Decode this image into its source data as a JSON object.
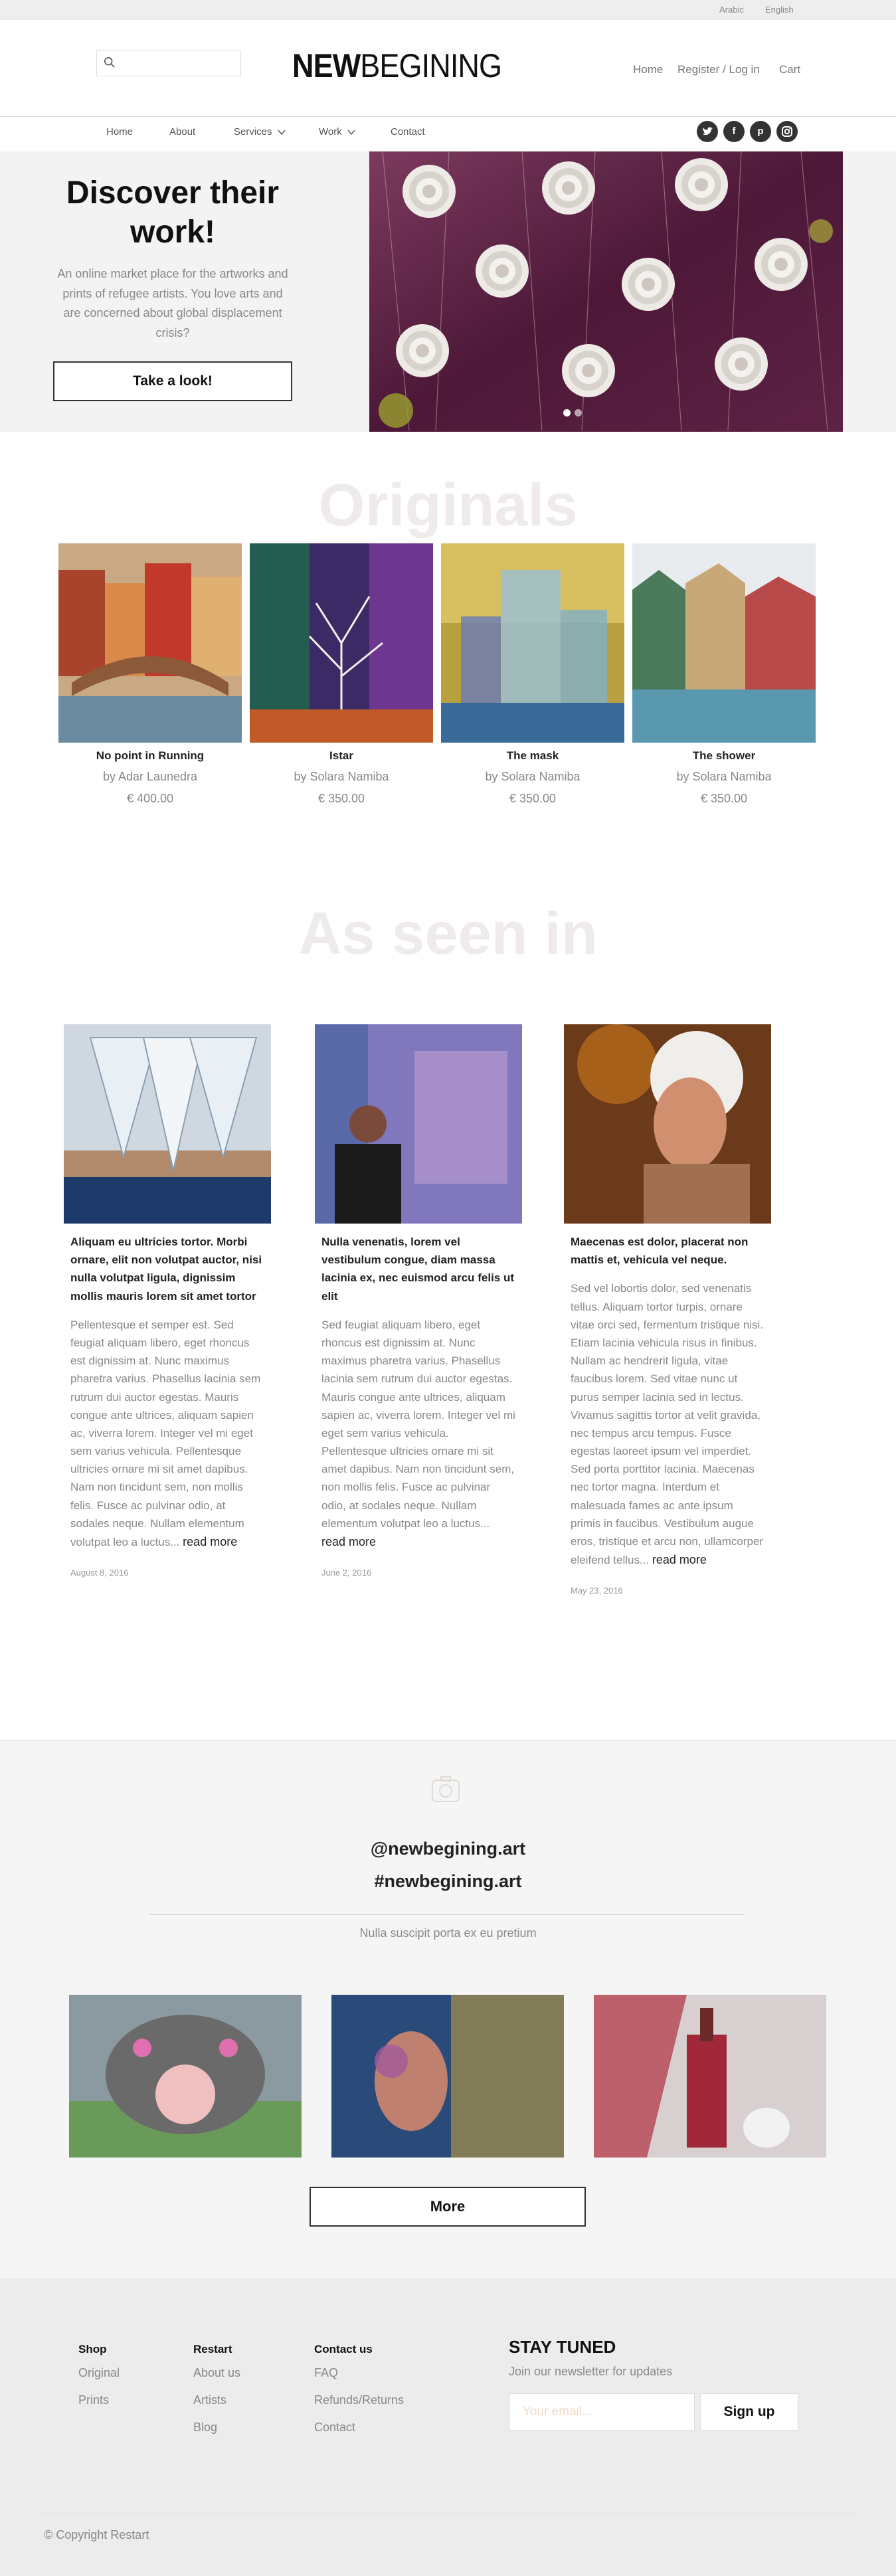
{
  "language_bar": {
    "arabic": "Arabic",
    "english": "English"
  },
  "header": {
    "search": {
      "value": "",
      "placeholder": "",
      "icon": "search-icon"
    },
    "logo": {
      "bold": "NEW",
      "regular": "BEGINING"
    },
    "links": {
      "home": "Home",
      "register": "Register / Log in",
      "cart": "Cart"
    }
  },
  "nav": {
    "items": [
      "Home",
      "About",
      "Services",
      "Work",
      "Contact"
    ],
    "dropdowns": [
      "Services",
      "Work"
    ],
    "social_icons": [
      "twitter-icon",
      "facebook-icon",
      "pinterest-icon",
      "instagram-icon"
    ]
  },
  "hero": {
    "title": "Discover their work!",
    "text": "An online market place for the artworks and prints of refugee artists. You love arts and are concerned about global displacement crisis?",
    "button": "Take a look!",
    "slide_count": 2,
    "active_slide": 1
  },
  "originals": {
    "heading": "Originals",
    "items": [
      {
        "title": "No point in Running",
        "by": "by Adar Launedra",
        "price": "€ 400.00"
      },
      {
        "title": "Istar",
        "by": "by Solara Namiba",
        "price": "€ 350.00"
      },
      {
        "title": "The mask",
        "by": "by Solara Namiba",
        "price": "€ 350.00"
      },
      {
        "title": "The shower",
        "by": "by Solara Namiba",
        "price": "€ 350.00"
      }
    ]
  },
  "press": {
    "heading": "As seen in",
    "read_more": "read more",
    "items": [
      {
        "title": "Aliquam eu ultricies tortor. Morbi ornare, elit non volutpat auctor, nisi nulla volutpat ligula, dignissim mollis mauris lorem sit amet tortor",
        "body": "Pellentesque et semper est. Sed feugiat aliquam libero, eget rhoncus est dignissim at. Nunc maximus pharetra varius. Phasellus lacinia sem rutrum dui auctor egestas. Mauris congue ante ultrices, aliquam sapien ac, viverra lorem. Integer vel mi eget sem varius vehicula. Pellentesque ultricies ornare mi sit amet dapibus. Nam non tincidunt sem, non mollis felis. Fusce ac pulvinar odio, at sodales neque. Nullam elementum volutpat leo a luctus...",
        "date": "August 8, 2016"
      },
      {
        "title": "Nulla venenatis, lorem vel vestibulum congue, diam massa lacinia ex, nec euismod arcu felis ut elit",
        "body": "Sed feugiat aliquam libero, eget rhoncus est dignissim at. Nunc maximus pharetra varius. Phasellus lacinia sem rutrum dui auctor egestas. Mauris congue ante ultrices, aliquam sapien ac, viverra lorem. Integer vel mi eget sem varius vehicula. Pellentesque ultricies ornare mi sit amet dapibus. Nam non tincidunt sem, non mollis felis. Fusce ac pulvinar odio, at sodales neque. Nullam elementum volutpat leo a luctus...",
        "date": "June 2, 2016"
      },
      {
        "title": "Maecenas est dolor, placerat non mattis et, vehicula vel neque.",
        "body": "Sed vel lobortis dolor, sed venenatis tellus. Aliquam tortor turpis, ornare vitae orci sed, fermentum tristique nisi. Etiam lacinia vehicula risus in finibus. Nullam ac hendrerit ligula, vitae faucibus lorem. Sed vitae nunc ut purus semper lacinia sed in lectus. Vivamus sagittis tortor at velit gravida, nec tempus arcu tempus. Fusce egestas laoreet ipsum vel imperdiet. Sed porta porttitor lacinia. Maecenas nec tortor magna. Interdum et malesuada fames ac ante ipsum primis in faucibus. Vestibulum augue eros, tristique et arcu non, ullamcorper eleifend tellus...",
        "date": "May 23, 2016"
      }
    ]
  },
  "instagram": {
    "icon": "camera-icon",
    "handle": "@newbegining.art",
    "hashtag": "#newbegining.art",
    "subtitle": "Nulla suscipit porta ex eu pretium",
    "more_button": "More"
  },
  "footer": {
    "columns": [
      {
        "heading": "Shop",
        "links": [
          "Original",
          "Prints"
        ]
      },
      {
        "heading": "Restart",
        "links": [
          "About us",
          "Artists",
          "Blog"
        ]
      },
      {
        "heading": "Contact us",
        "links": [
          "FAQ",
          "Refunds/Returns",
          "Contact"
        ]
      }
    ],
    "newsletter": {
      "heading": "STAY TUNED",
      "subtitle": "Join our newsletter for updates",
      "email_placeholder": "Your email...",
      "button": "Sign up"
    },
    "copyright": "© Copyright Restart"
  }
}
